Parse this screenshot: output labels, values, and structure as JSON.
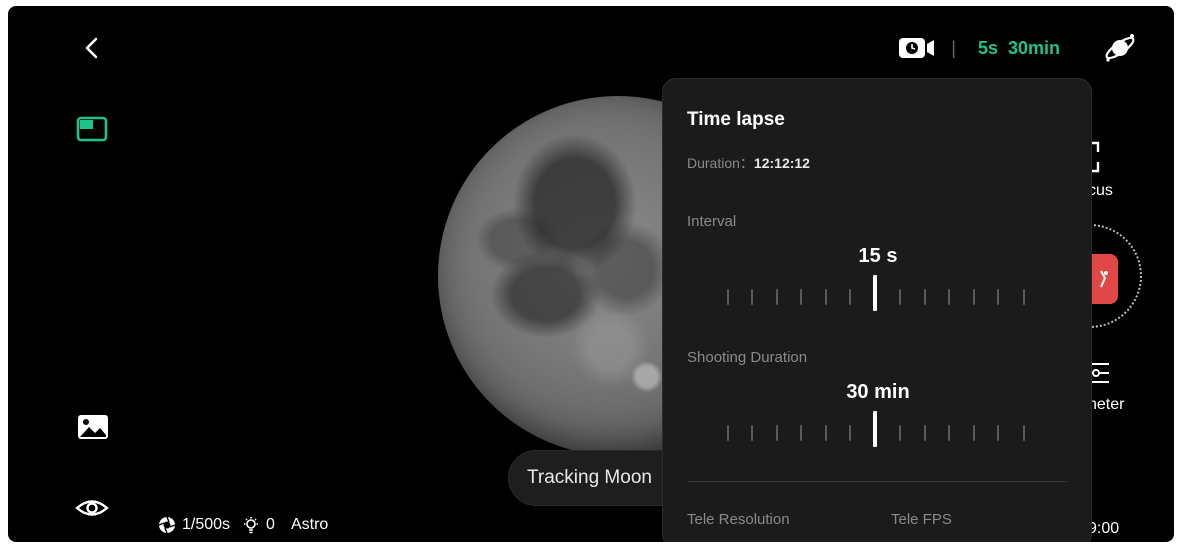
{
  "header": {
    "timelapse_interval": "5s",
    "timelapse_duration": "30min",
    "separator": "|"
  },
  "status": {
    "shutter": "1/500s",
    "exposure": "0",
    "mode": "Astro"
  },
  "tracking": {
    "label": "Tracking Moon"
  },
  "right_controls": {
    "focus_label": "cus",
    "parameter_label": "neter",
    "time_label": "9:00"
  },
  "panel": {
    "title": "Time lapse",
    "duration_label": "Duration：",
    "duration_value": "12:12:12",
    "interval_label": "Interval",
    "interval_value": "15 s",
    "shooting_duration_label": "Shooting Duration",
    "shooting_duration_value": "30 min",
    "tele_resolution_label": "Tele Resolution",
    "tele_fps_label": "Tele FPS"
  },
  "colors": {
    "accent": "#1fc48a",
    "shutter_red": "#e04848",
    "panel_bg": "#1b1b1b"
  }
}
